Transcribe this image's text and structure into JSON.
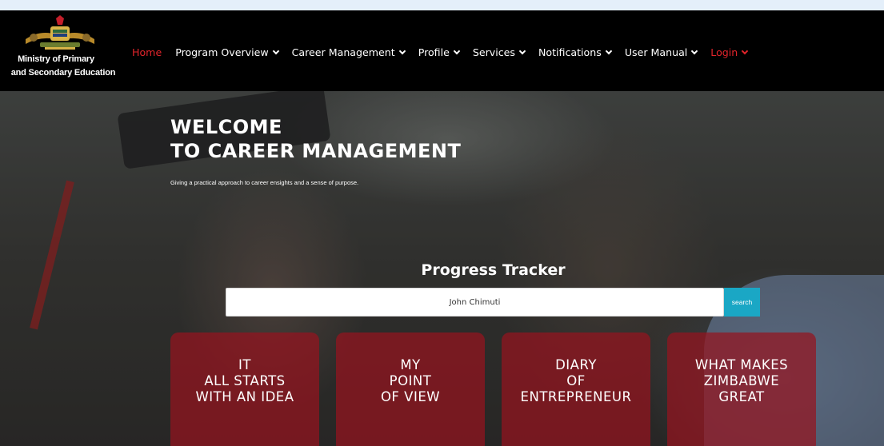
{
  "brand": {
    "line1": "Ministry of Primary",
    "line2": "and Secondary Education"
  },
  "nav": {
    "items": [
      {
        "label": "Home",
        "chevron": false,
        "state": "active"
      },
      {
        "label": "Program Overview",
        "chevron": true
      },
      {
        "label": "Career Management",
        "chevron": true
      },
      {
        "label": "Profile",
        "chevron": true
      },
      {
        "label": "Services",
        "chevron": true
      },
      {
        "label": "Notifications",
        "chevron": true
      },
      {
        "label": "User Manual",
        "chevron": true
      },
      {
        "label": "Login",
        "chevron": true,
        "state": "highlight"
      }
    ]
  },
  "hero": {
    "welcome_line1": "WELCOME",
    "welcome_line2": "TO CAREER MANAGEMENT",
    "tagline": "Giving a practical approach to career ensights and a sense of purpose."
  },
  "tracker": {
    "title": "Progress Tracker",
    "input_value": "John Chimuti",
    "search_label": "search"
  },
  "cards": [
    {
      "lines": [
        "IT",
        "ALL STARTS",
        "WITH AN IDEA"
      ]
    },
    {
      "lines": [
        "MY",
        "POINT",
        "OF VIEW"
      ]
    },
    {
      "lines": [
        "DIARY",
        "OF",
        "ENTREPRENEUR"
      ]
    },
    {
      "lines": [
        "WHAT MAKES",
        "ZIMBABWE",
        "GREAT"
      ]
    }
  ],
  "colors": {
    "accent_red": "#e3242b",
    "search_button": "#1aa7c5",
    "card_bg": "#961420",
    "navbar_bg": "#000000"
  },
  "icons": {
    "logo": "coat-of-arms",
    "dropdown": "chevron-down-icon"
  }
}
